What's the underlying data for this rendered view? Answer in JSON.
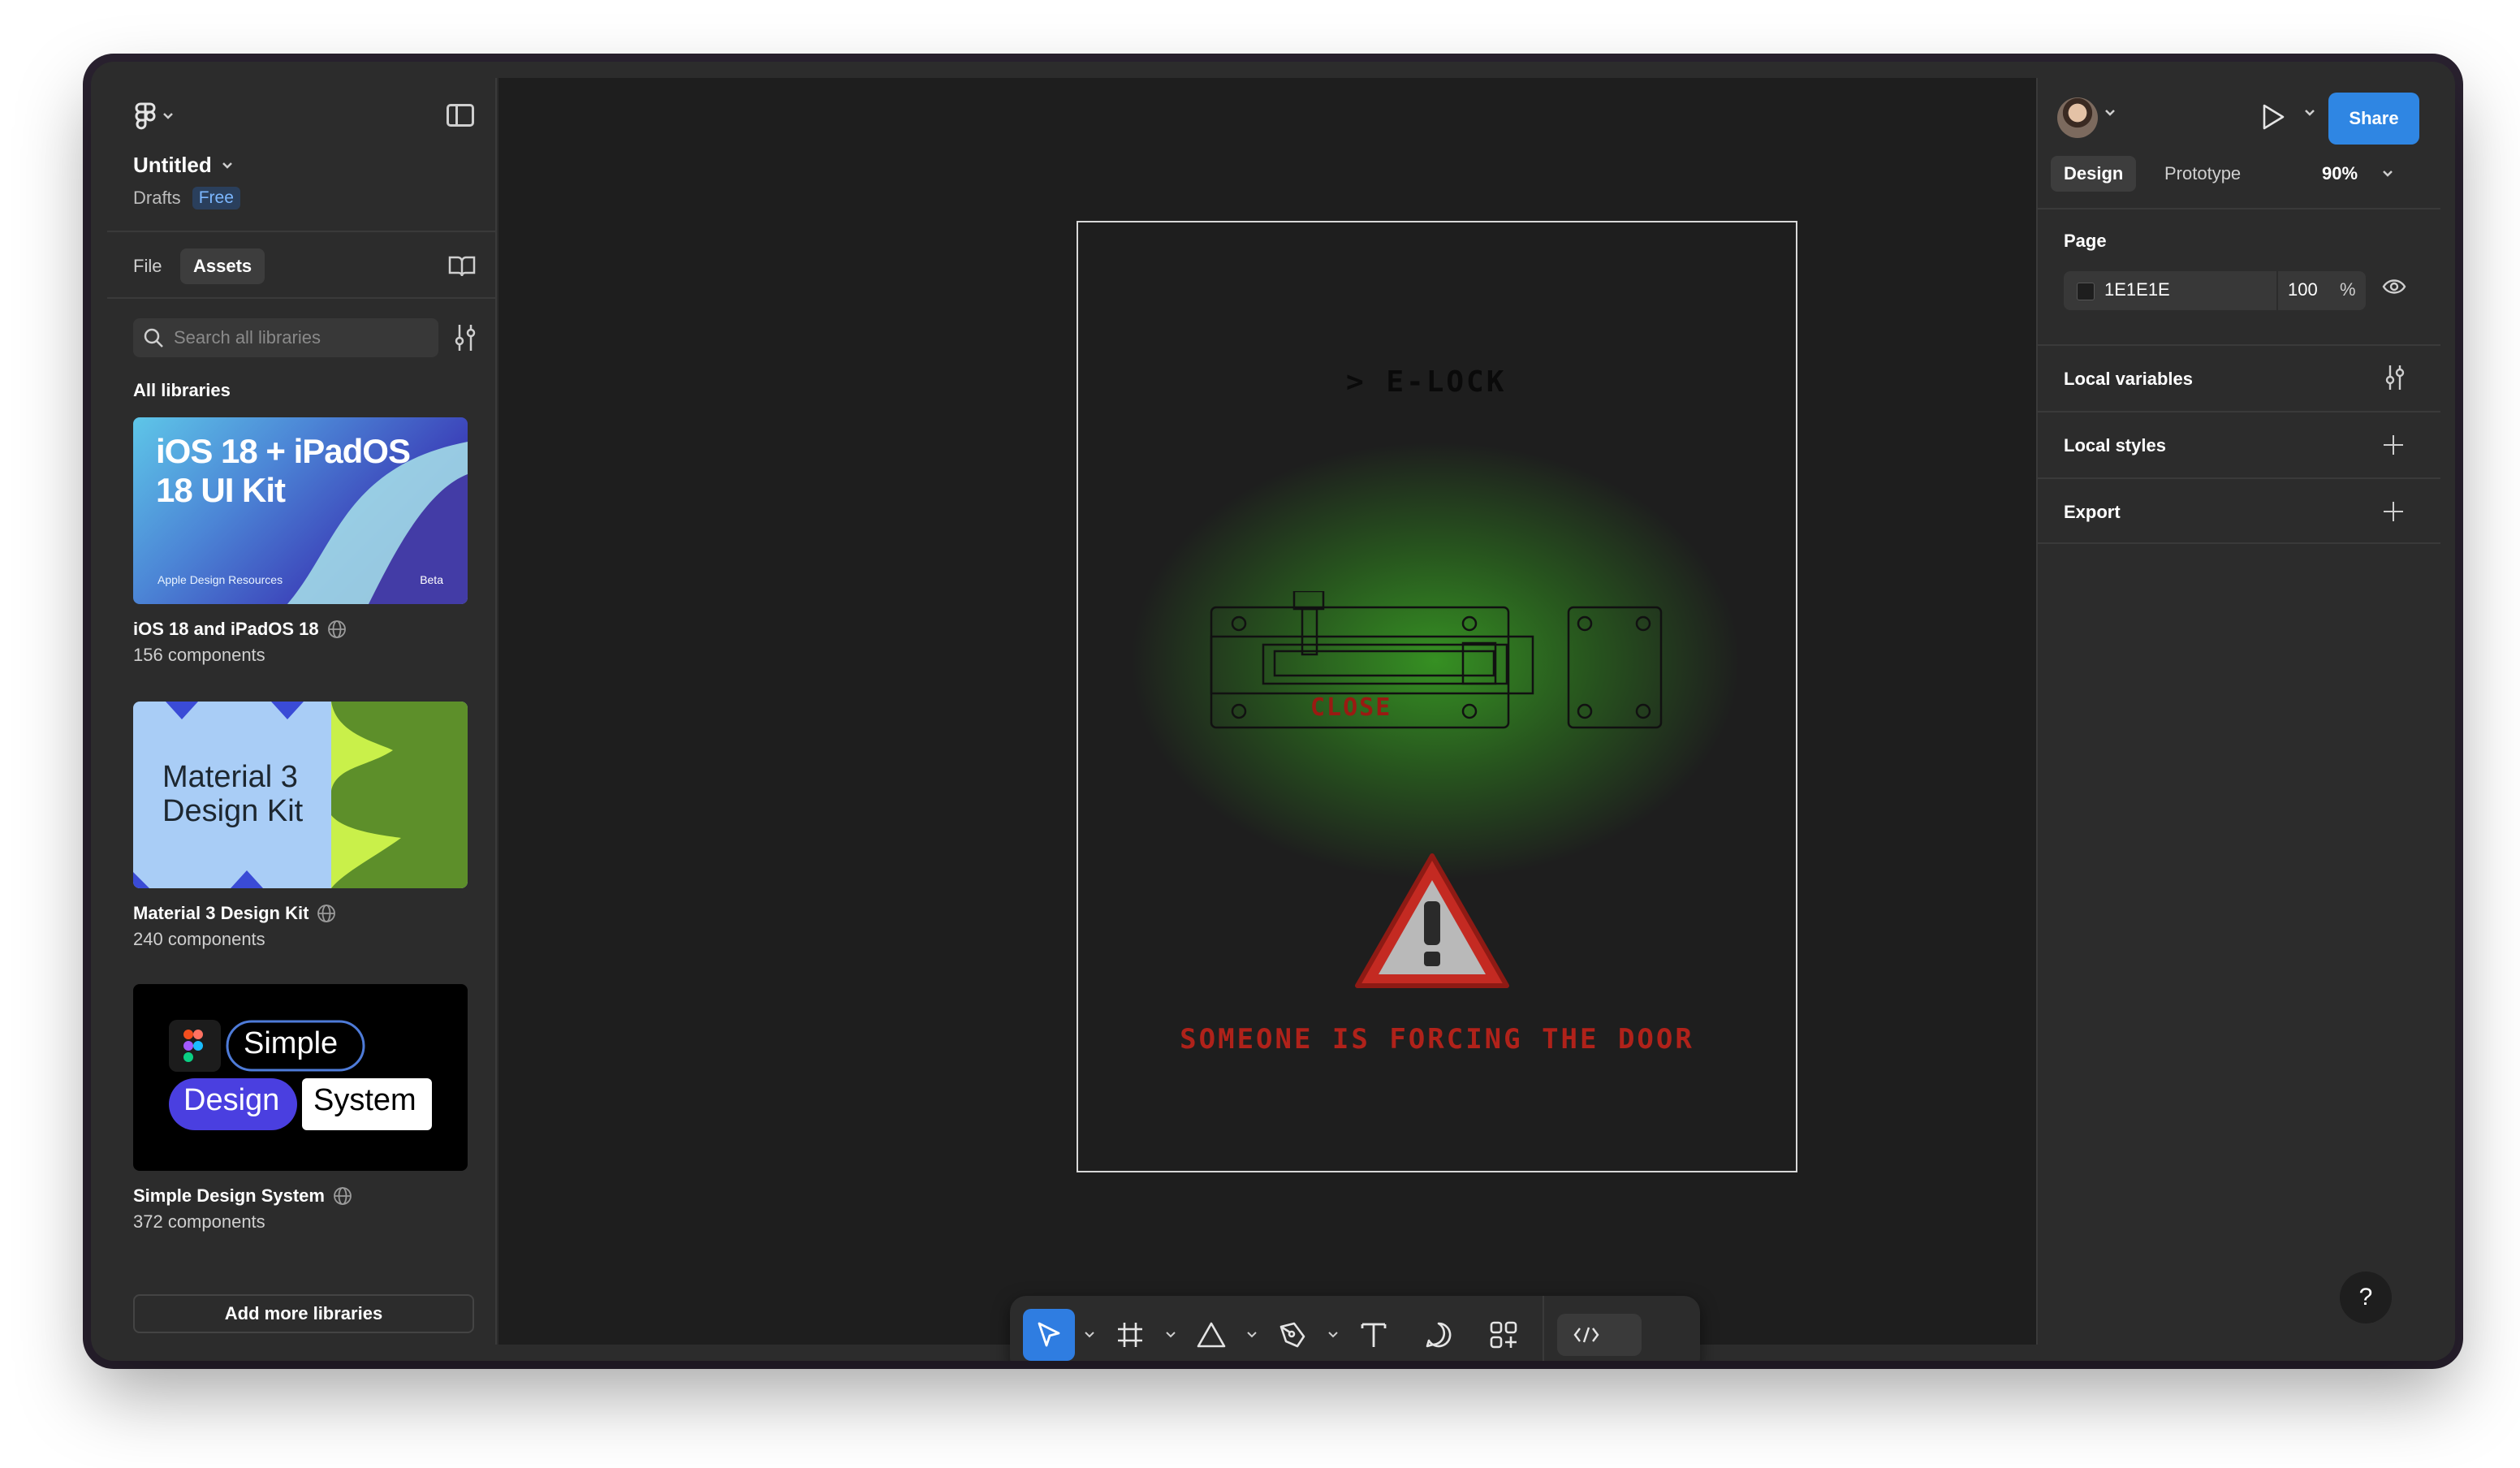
{
  "file": {
    "title": "Untitled",
    "location": "Drafts",
    "plan": "Free"
  },
  "left_tabs": {
    "file": "File",
    "assets": "Assets"
  },
  "search": {
    "placeholder": "Search all libraries"
  },
  "libraries": {
    "heading": "All libraries",
    "items": [
      {
        "name": "iOS 18 and iPadOS 18",
        "count": "156 components",
        "thumb_title": "iOS 18 + iPadOS 18 UI Kit",
        "thumb_footer": "Apple Design Resources",
        "thumb_badge": "Beta"
      },
      {
        "name": "Material 3 Design Kit",
        "count": "240 components",
        "thumb_title": "Material 3 Design Kit"
      },
      {
        "name": "Simple Design System",
        "count": "372 components",
        "thumb_words": [
          "Simple",
          "Design",
          "System"
        ]
      }
    ],
    "add_button": "Add more libraries"
  },
  "canvas_frame": {
    "title": "> E-LOCK",
    "lock_state": "CLOSE",
    "alert": "SOMEONE IS FORCING THE DOOR",
    "glow_color": "#3c9626",
    "alert_color": "#b0221a"
  },
  "toolbar": {
    "tools": [
      "move-tool",
      "frame-tool",
      "shape-tool",
      "pen-tool",
      "text-tool",
      "comment-tool",
      "actions-tool",
      "dev-mode-toggle"
    ],
    "active_tool": "move-tool"
  },
  "right_panel": {
    "share": "Share",
    "tabs": {
      "design": "Design",
      "prototype": "Prototype"
    },
    "zoom": "90%",
    "page": {
      "title": "Page",
      "fill_hex": "1E1E1E",
      "opacity": "100",
      "unit": "%"
    },
    "sections": {
      "local_variables": "Local variables",
      "local_styles": "Local styles",
      "export": "Export"
    },
    "help": "?"
  },
  "colors": {
    "accent": "#2f86e3",
    "panel_bg": "#2c2c2c",
    "canvas_bg": "#1e1e1e"
  }
}
